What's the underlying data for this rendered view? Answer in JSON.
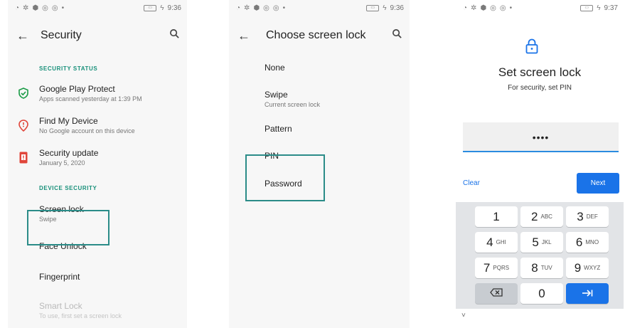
{
  "screen1": {
    "status": {
      "time": "9:36"
    },
    "title": "Security",
    "section_status": "SECURITY STATUS",
    "items": [
      {
        "title": "Google Play Protect",
        "subtitle": "Apps scanned yesterday at 1:39 PM"
      },
      {
        "title": "Find My Device",
        "subtitle": "No Google account on this device"
      },
      {
        "title": "Security update",
        "subtitle": "January 5, 2020"
      }
    ],
    "section_device": "DEVICE SECURITY",
    "screen_lock": {
      "title": "Screen lock",
      "subtitle": "Swipe"
    },
    "face_unlock": "Face Unlock",
    "fingerprint": "Fingerprint",
    "smart_lock": {
      "title": "Smart Lock",
      "subtitle": "To use, first set a screen lock"
    }
  },
  "screen2": {
    "status": {
      "time": "9:36"
    },
    "title": "Choose screen lock",
    "options": {
      "none": "None",
      "swipe": "Swipe",
      "swipe_sub": "Current screen lock",
      "pattern": "Pattern",
      "pin": "PIN",
      "password": "Password"
    }
  },
  "screen3": {
    "status": {
      "time": "9:37"
    },
    "title": "Set screen lock",
    "subtitle": "For security, set PIN",
    "pin_value": "••••",
    "clear_label": "Clear",
    "next_label": "Next",
    "keys": [
      {
        "d": "1",
        "l": ""
      },
      {
        "d": "2",
        "l": "ABC"
      },
      {
        "d": "3",
        "l": "DEF"
      },
      {
        "d": "4",
        "l": "GHI"
      },
      {
        "d": "5",
        "l": "JKL"
      },
      {
        "d": "6",
        "l": "MNO"
      },
      {
        "d": "7",
        "l": "PQRS"
      },
      {
        "d": "8",
        "l": "TUV"
      },
      {
        "d": "9",
        "l": "WXYZ"
      }
    ],
    "zero": "0"
  },
  "colors": {
    "accent_green": "#18907a",
    "highlight_box": "#2b8c88",
    "blue": "#1a73e8"
  }
}
